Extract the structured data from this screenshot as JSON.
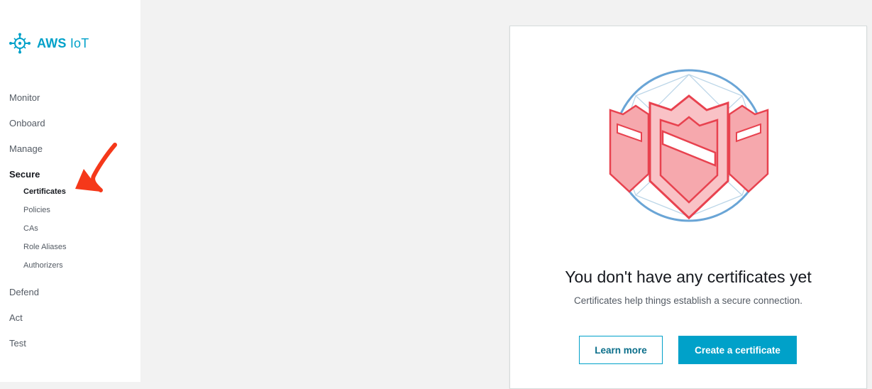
{
  "app": {
    "logo_text_main": "AWS",
    "logo_text_sub": "IoT"
  },
  "sidebar": {
    "items": [
      {
        "label": "Monitor"
      },
      {
        "label": "Onboard"
      },
      {
        "label": "Manage"
      },
      {
        "label": "Secure",
        "active": true
      },
      {
        "label": "Defend"
      },
      {
        "label": "Act"
      },
      {
        "label": "Test"
      }
    ],
    "secure_subitems": [
      {
        "label": "Certificates",
        "active": true
      },
      {
        "label": "Policies"
      },
      {
        "label": "CAs"
      },
      {
        "label": "Role Aliases"
      },
      {
        "label": "Authorizers"
      }
    ]
  },
  "empty_state": {
    "title": "You don't have any certificates yet",
    "description": "Certificates help things establish a secure connection.",
    "learn_more_label": "Learn more",
    "create_label": "Create a certificate"
  },
  "colors": {
    "accent": "#00a1c9",
    "annotation_arrow": "#f5381a",
    "shield_red": "#e8424f"
  }
}
